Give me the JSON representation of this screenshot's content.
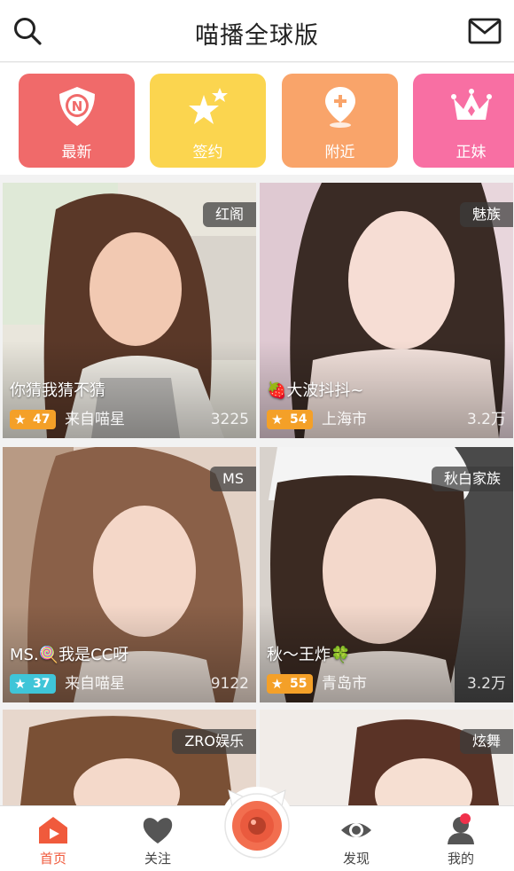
{
  "header": {
    "title": "喵播全球版"
  },
  "categories": [
    {
      "label": "最新",
      "color": "#f06a6a",
      "icon": "shield-n-icon"
    },
    {
      "label": "签约",
      "color": "#fbd54f",
      "icon": "stars-icon"
    },
    {
      "label": "附近",
      "color": "#f9a46a",
      "icon": "location-pin-icon"
    },
    {
      "label": "正妹",
      "color": "#f86fa3",
      "icon": "crown-icon"
    }
  ],
  "cards": [
    {
      "tag": "红阁",
      "caption": "你猜我猜不猜",
      "level": "47",
      "level_color": "#f4a028",
      "location": "来自喵星",
      "count": "3225"
    },
    {
      "tag": "魅族",
      "caption": "🍓大波抖抖~",
      "level": "54",
      "level_color": "#f4a028",
      "location": "上海市",
      "count": "3.2万"
    },
    {
      "tag": "MS",
      "caption": "MS.🍭我是CC呀",
      "level": "37",
      "level_color": "#3fc5d8",
      "location": "来自喵星",
      "count": "9122"
    },
    {
      "tag": "秋白家族",
      "caption": "秋～王炸🍀",
      "level": "55",
      "level_color": "#f4a028",
      "location": "青岛市",
      "count": "3.2万"
    },
    {
      "tag": "ZRO娱乐",
      "caption": "",
      "level": "",
      "level_color": "#f4a028",
      "location": "",
      "count": ""
    },
    {
      "tag": "炫舞",
      "caption": "",
      "level": "",
      "level_color": "#f4a028",
      "location": "",
      "count": ""
    }
  ],
  "tabs": [
    {
      "label": "首页",
      "icon": "home-play-icon",
      "active": true
    },
    {
      "label": "关注",
      "icon": "heart-icon",
      "active": false
    },
    {
      "label": "发现",
      "icon": "eye-icon",
      "active": false
    },
    {
      "label": "我的",
      "icon": "user-icon",
      "active": false
    }
  ]
}
